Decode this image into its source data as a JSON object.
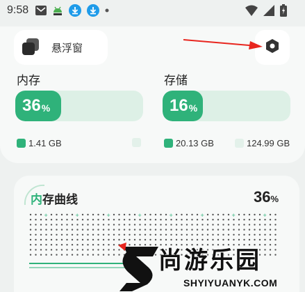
{
  "status_bar": {
    "time": "9:58",
    "icons": [
      "mail-icon",
      "android-debug-icon",
      "download-icon",
      "download-icon",
      "dot-icon"
    ],
    "right_icons": [
      "wifi-icon",
      "signal-icon",
      "battery-icon"
    ]
  },
  "top": {
    "float_window_label": "悬浮窗",
    "settings_icon": "hexagon-settings-icon"
  },
  "memory": {
    "title": "内存",
    "percent": "36",
    "percent_symbol": "%",
    "fill_fraction": 0.36,
    "used": "1.41 GB",
    "free": ""
  },
  "storage": {
    "title": "存储",
    "percent": "16",
    "percent_symbol": "%",
    "fill_fraction": 0.16,
    "used": "20.13 GB",
    "total": "124.99 GB"
  },
  "memory_curve": {
    "title_highlight": "内",
    "title_rest": "存曲线",
    "value": "36",
    "value_symbol": "%"
  },
  "watermark": {
    "brand_cn": "尚游乐园",
    "brand_en": "SHYIYUANYK.COM"
  },
  "colors": {
    "accent": "#2fb27a",
    "accent_light": "#ddf0e6",
    "background": "#eef1f0",
    "card": "#f7f9f8",
    "annotation_arrow": "#e8261f"
  }
}
